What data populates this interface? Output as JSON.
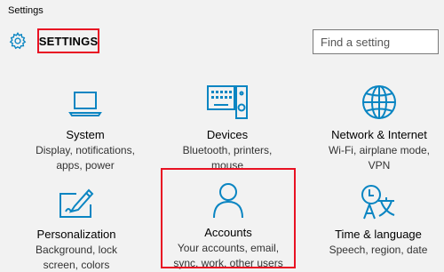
{
  "window": {
    "title": "Settings"
  },
  "header": {
    "title": "SETTINGS"
  },
  "search": {
    "placeholder": "Find a setting"
  },
  "tiles": [
    {
      "name": "System",
      "desc1": "Display, notifications,",
      "desc2": "apps, power",
      "desc3": ""
    },
    {
      "name": "Devices",
      "desc1": "Bluetooth, printers,",
      "desc2": "mouse",
      "desc3": ""
    },
    {
      "name": "Network & Internet",
      "desc1": "Wi-Fi, airplane mode,",
      "desc2": "VPN",
      "desc3": ""
    },
    {
      "name": "Personalization",
      "desc1": "Background, lock",
      "desc2": "screen, colors",
      "desc3": ""
    },
    {
      "name": "Accounts",
      "desc1": "Your accounts, email,",
      "desc2": "sync, work, other users",
      "desc3": ""
    },
    {
      "name": "Time & language",
      "desc1": "Speech, region, date",
      "desc2": "",
      "desc3": ""
    }
  ],
  "colors": {
    "accent": "#0a85c2",
    "highlight": "#e81123",
    "background": "#f2f2f2"
  },
  "icons": {
    "header": "gear-icon",
    "tiles": [
      "laptop-icon",
      "keyboard-speaker-icon",
      "globe-icon",
      "pen-tablet-icon",
      "person-icon",
      "time-language-icon"
    ]
  }
}
